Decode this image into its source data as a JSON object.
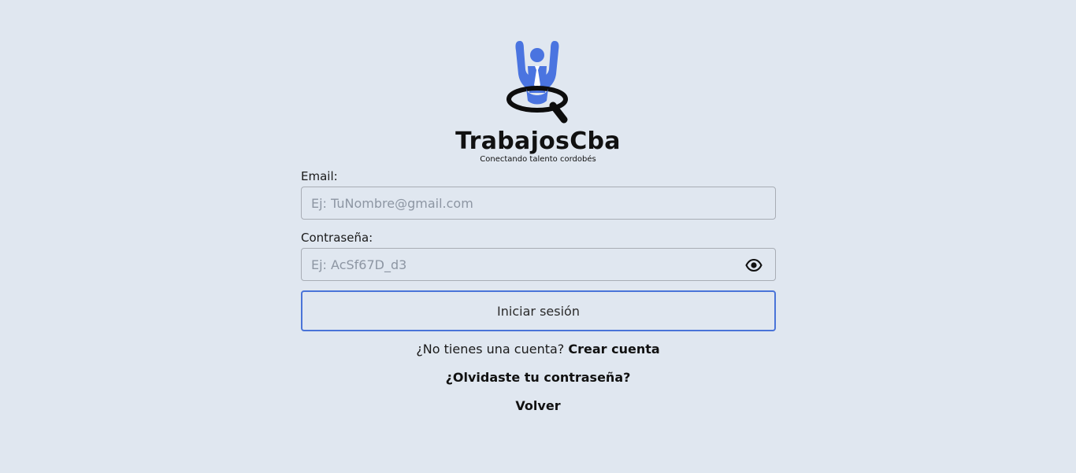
{
  "brand": {
    "name": "TrabajosCba",
    "tagline": "Conectando talento cordobés",
    "colors": {
      "accent": "#4a74d8",
      "logo_blue": "#4a74e0",
      "background": "#e0e7f0"
    }
  },
  "form": {
    "email": {
      "label": "Email:",
      "placeholder": "Ej: TuNombre@gmail.com",
      "value": ""
    },
    "password": {
      "label": "Contraseña:",
      "placeholder": "Ej: AcSf67D_d3",
      "value": "",
      "toggle_icon": "eye-icon"
    },
    "submit_label": "Iniciar sesión"
  },
  "links": {
    "signup_prompt": "¿No tienes una cuenta?",
    "signup_link": "Crear cuenta",
    "forgot_password": "¿Olvidaste tu contraseña?",
    "back": "Volver"
  }
}
